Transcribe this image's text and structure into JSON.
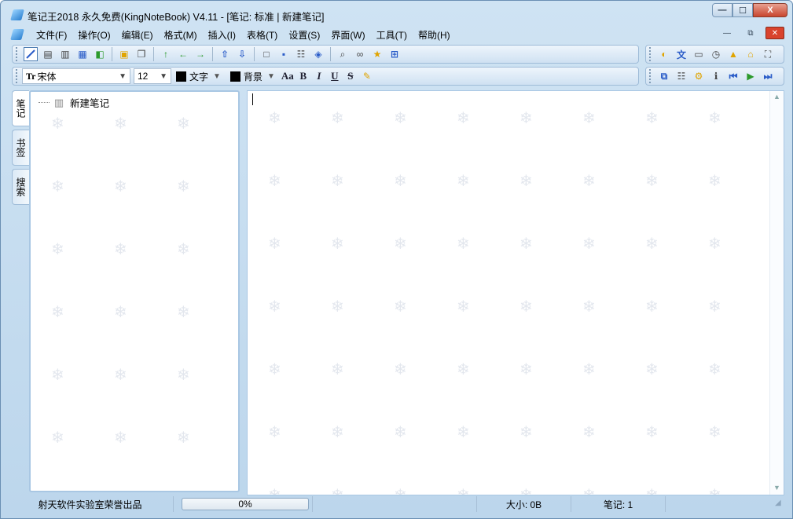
{
  "window": {
    "title": "笔记王2018 永久免费(KingNoteBook) V4.11 - [笔记: 标准 | 新建笔记]",
    "caption_min": "—",
    "caption_max": "☐",
    "caption_close": "X"
  },
  "menu": [
    "文件(F)",
    "操作(O)",
    "编辑(E)",
    "格式(M)",
    "插入(I)",
    "表格(T)",
    "设置(S)",
    "界面(W)",
    "工具(T)",
    "帮助(H)"
  ],
  "mdi": {
    "min": "—",
    "restore": "⧉",
    "close": "✕"
  },
  "format_bar": {
    "font_name": "宋体",
    "font_prefix": "Tr",
    "font_size": "12",
    "text_color_label": "文字",
    "bg_color_label": "背景",
    "fmt_buttons": [
      "Aa",
      "B",
      "I",
      "U",
      "S"
    ]
  },
  "side_tabs": [
    "笔记",
    "书签",
    "搜索"
  ],
  "tree": {
    "items": [
      {
        "label": "新建笔记"
      }
    ]
  },
  "status": {
    "credit": "射天软件实验室荣誉出品",
    "progress_text": "0%",
    "progress_value": 0,
    "size": "大小: 0B",
    "notes": "笔记: 1"
  },
  "icons": {
    "toolbar_main": [
      "pen-icon",
      "panel1-icon",
      "panel2-icon",
      "panel3-icon",
      "export-icon",
      "paste-icon",
      "copy-icon",
      "arrow-up-icon",
      "arrow-left-icon",
      "arrow-right-icon",
      "move-up-icon",
      "move-down-icon",
      "new-doc-icon",
      "save-icon",
      "table-icon",
      "print-icon",
      "preview-icon",
      "binoculars-icon",
      "star-icon",
      "outline-icon"
    ],
    "toolbar_right": [
      "sound-icon",
      "translate-icon",
      "camera-icon",
      "clock-icon",
      "lock-icon",
      "home-icon",
      "fullscreen-icon"
    ],
    "toolbar_right2": [
      "window-icon",
      "grid-icon",
      "settings-icon",
      "info-icon",
      "first-icon",
      "play-icon",
      "last-icon"
    ]
  }
}
